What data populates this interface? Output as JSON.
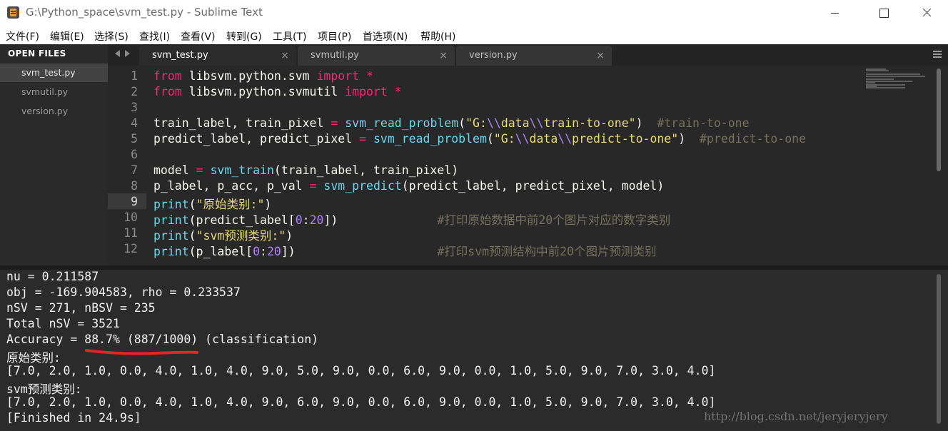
{
  "window": {
    "title": "G:\\Python_space\\svm_test.py - Sublime Text"
  },
  "menu": [
    "文件(F)",
    "编辑(E)",
    "选择(S)",
    "查找(I)",
    "查看(V)",
    "转到(G)",
    "工具(T)",
    "项目(P)",
    "首选项(N)",
    "帮助(H)"
  ],
  "sidebar": {
    "header": "OPEN FILES",
    "files": [
      "svm_test.py",
      "svmutil.py",
      "version.py"
    ],
    "active_index": 0
  },
  "tabs": [
    {
      "label": "svm_test.py",
      "close": "×"
    },
    {
      "label": "svmutil.py",
      "close": "×"
    },
    {
      "label": "version.py",
      "close": "×"
    }
  ],
  "editor": {
    "highlighted_line": 9,
    "line_numbers": [
      "1",
      "2",
      "3",
      "4",
      "5",
      "6",
      "7",
      "8",
      "9",
      "10",
      "11",
      "12"
    ],
    "code": [
      [
        [
          "kw",
          "from"
        ],
        [
          "plain",
          " libsvm.python.svm "
        ],
        [
          "kw",
          "import"
        ],
        [
          "plain",
          " "
        ],
        [
          "kw",
          "*"
        ]
      ],
      [
        [
          "kw",
          "from"
        ],
        [
          "plain",
          " libsvm.python.svmutil "
        ],
        [
          "kw",
          "import"
        ],
        [
          "plain",
          " "
        ],
        [
          "kw",
          "*"
        ]
      ],
      [],
      [
        [
          "plain",
          "train_label, train_pixel "
        ],
        [
          "kw",
          "="
        ],
        [
          "plain",
          " "
        ],
        [
          "fn",
          "svm_read_problem"
        ],
        [
          "plain",
          "("
        ],
        [
          "str",
          "\"G:"
        ],
        [
          "esc",
          "\\\\"
        ],
        [
          "str",
          "data"
        ],
        [
          "esc",
          "\\\\"
        ],
        [
          "str",
          "train-to-one\""
        ],
        [
          "plain",
          ")  "
        ],
        [
          "cmt",
          "#train-to-one"
        ]
      ],
      [
        [
          "plain",
          "predict_label, predict_pixel "
        ],
        [
          "kw",
          "="
        ],
        [
          "plain",
          " "
        ],
        [
          "fn",
          "svm_read_problem"
        ],
        [
          "plain",
          "("
        ],
        [
          "str",
          "\"G:"
        ],
        [
          "esc",
          "\\\\"
        ],
        [
          "str",
          "data"
        ],
        [
          "esc",
          "\\\\"
        ],
        [
          "str",
          "predict-to-one\""
        ],
        [
          "plain",
          ")  "
        ],
        [
          "cmt",
          "#predict-to-one"
        ]
      ],
      [],
      [
        [
          "plain",
          "model "
        ],
        [
          "kw",
          "="
        ],
        [
          "plain",
          " "
        ],
        [
          "fn",
          "svm_train"
        ],
        [
          "plain",
          "(train_label, train_pixel)"
        ]
      ],
      [
        [
          "plain",
          "p_label, p_acc, p_val "
        ],
        [
          "kw",
          "="
        ],
        [
          "plain",
          " "
        ],
        [
          "fn",
          "svm_predict"
        ],
        [
          "plain",
          "(predict_label, predict_pixel, model)"
        ]
      ],
      [
        [
          "fn",
          "print"
        ],
        [
          "plain",
          "("
        ],
        [
          "str",
          "\"原始类别:\""
        ],
        [
          "plain",
          ")"
        ]
      ],
      [
        [
          "fn",
          "print"
        ],
        [
          "plain",
          "(predict_label["
        ],
        [
          "num",
          "0"
        ],
        [
          "plain",
          ":"
        ],
        [
          "num",
          "20"
        ],
        [
          "plain",
          "])              "
        ],
        [
          "cmt",
          "#打印原始数据中前20个图片对应的数字类别"
        ]
      ],
      [
        [
          "fn",
          "print"
        ],
        [
          "plain",
          "("
        ],
        [
          "str",
          "\"svm预测类别:\""
        ],
        [
          "plain",
          ")"
        ]
      ],
      [
        [
          "fn",
          "print"
        ],
        [
          "plain",
          "(p_label["
        ],
        [
          "num",
          "0"
        ],
        [
          "plain",
          ":"
        ],
        [
          "num",
          "20"
        ],
        [
          "plain",
          "])                    "
        ],
        [
          "cmt",
          "#打印svm预测结构中前20个图片预测类别"
        ]
      ]
    ]
  },
  "output": {
    "lines": [
      "nu = 0.211587",
      "obj = -169.904583, rho = 0.233537",
      "nSV = 271, nBSV = 235",
      "Total nSV = 3521",
      "Accuracy = 88.7% (887/1000) (classification)",
      "原始类别:",
      "[7.0, 2.0, 1.0, 0.0, 4.0, 1.0, 4.0, 9.0, 5.0, 9.0, 0.0, 6.0, 9.0, 0.0, 1.0, 5.0, 9.0, 7.0, 3.0, 4.0]",
      "svm预测类别:",
      "[7.0, 2.0, 1.0, 0.0, 4.0, 1.0, 4.0, 9.0, 6.0, 9.0, 0.0, 6.0, 9.0, 0.0, 1.0, 5.0, 9.0, 7.0, 3.0, 4.0]",
      "[Finished in 24.9s]"
    ],
    "watermark": "http://blog.csdn.net/jeryjeryjery"
  },
  "colors": {
    "keyword": "#f92672",
    "function": "#66d9ef",
    "string": "#e6db74",
    "number": "#ae81ff",
    "comment": "#75715e",
    "annotation": "#e0242a"
  }
}
